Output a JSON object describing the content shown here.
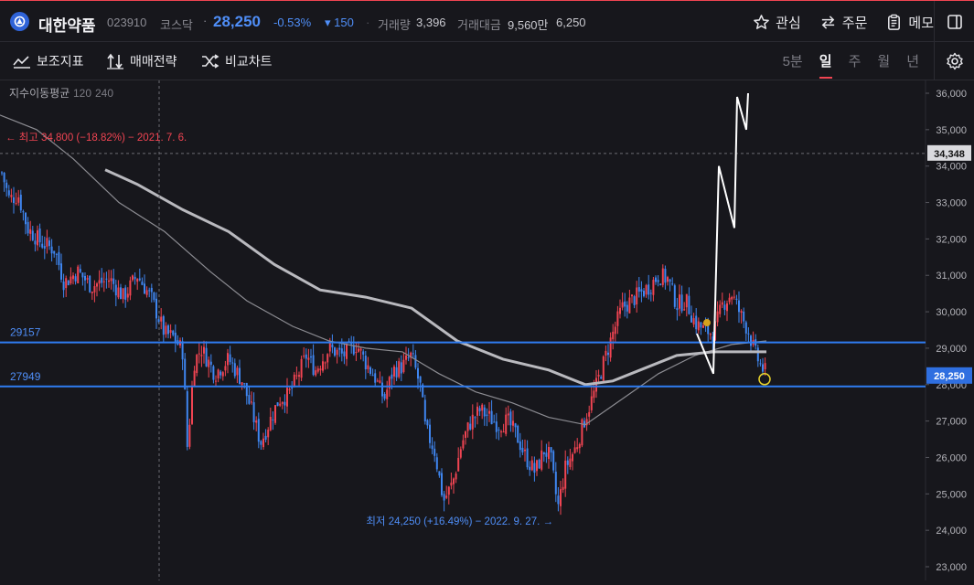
{
  "header": {
    "name": "대한약품",
    "code": "023910",
    "market": "코스닥",
    "separator": "·",
    "price": "28,250",
    "change_pct": "-0.53%",
    "change_abs": "▾ 150",
    "volume_label": "거래량",
    "volume_value": "3,396",
    "amount_label": "거래대금",
    "amount_value": "9,560만",
    "extra_value": "6,250",
    "actions": {
      "watch": "관심",
      "order": "주문",
      "memo": "메모"
    }
  },
  "toolbar": {
    "indicator": "보조지표",
    "strategy": "매매전략",
    "compare": "비교차트",
    "periods": [
      "5분",
      "일",
      "주",
      "월",
      "년"
    ],
    "active_period": "일"
  },
  "chart_data": {
    "type": "candlestick",
    "ma_label": "지수이동평균",
    "ma_periods": [
      "120",
      "240"
    ],
    "y_ticks": [
      "36,000",
      "35,000",
      "34,000",
      "33,000",
      "32,000",
      "31,000",
      "30,000",
      "29,000",
      "28,000",
      "27,000",
      "26,000",
      "25,000",
      "24,000",
      "23,000"
    ],
    "ylim": [
      23000,
      36300
    ],
    "crosshair_price": "34,348",
    "current_price_tag": "28,250",
    "high_annotation": "← 최고 34,800 (−18.82%) − 2021. 7. 6.",
    "low_annotation": "최저 24,250 (+16.49%) − 2022. 9. 27. →",
    "hlines": [
      {
        "label": "29157",
        "value": 29157
      },
      {
        "label": "27949",
        "value": 27949
      }
    ],
    "colors": {
      "up": "#f04452",
      "down": "#3f86f0",
      "hline": "#2f7cf0",
      "ma120": "#b9b9be",
      "ma240": "#8c8c92"
    }
  }
}
